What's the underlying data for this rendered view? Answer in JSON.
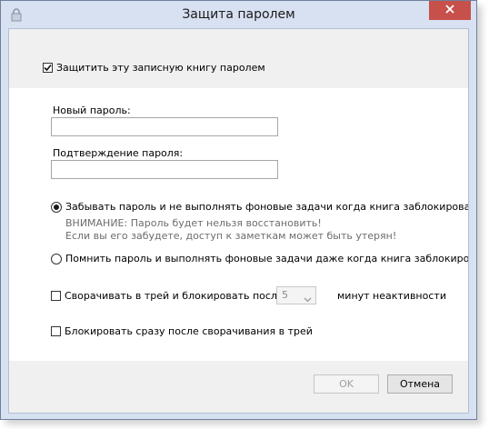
{
  "window": {
    "title": "Защита паролем",
    "icons": {
      "app": "lock-icon",
      "close": "close-icon"
    }
  },
  "protect_checkbox": {
    "label": "Защитить эту записную книгу паролем",
    "checked": true
  },
  "new_password": {
    "label": "Новый пароль:",
    "value": ""
  },
  "confirm_password": {
    "label": "Подтверждение пароля:",
    "value": ""
  },
  "option_forget": {
    "label": "Забывать пароль и не выполнять фоновые задачи когда книга заблокирована",
    "selected": true,
    "warning_line1": "ВНИМАНИЕ: Пароль будет нельзя восстановить!",
    "warning_line2": "Если вы его забудете, доступ к заметкам может быть утерян!"
  },
  "option_remember": {
    "label": "Помнить пароль и выполнять фоновые задачи даже когда книга заблокирована",
    "selected": false
  },
  "minimize_lock": {
    "label": "Сворачивать в трей и блокировать после",
    "checked": false,
    "minutes_value": "5",
    "suffix": "минут неактивности"
  },
  "lock_immediately": {
    "label": "Блокировать сразу после сворачивания в трей",
    "checked": false
  },
  "buttons": {
    "ok": "OK",
    "cancel": "Отмена"
  },
  "colors": {
    "close_button": "#c7504b",
    "frame": "#d8e1f2",
    "panel": "#f0f0f0"
  }
}
